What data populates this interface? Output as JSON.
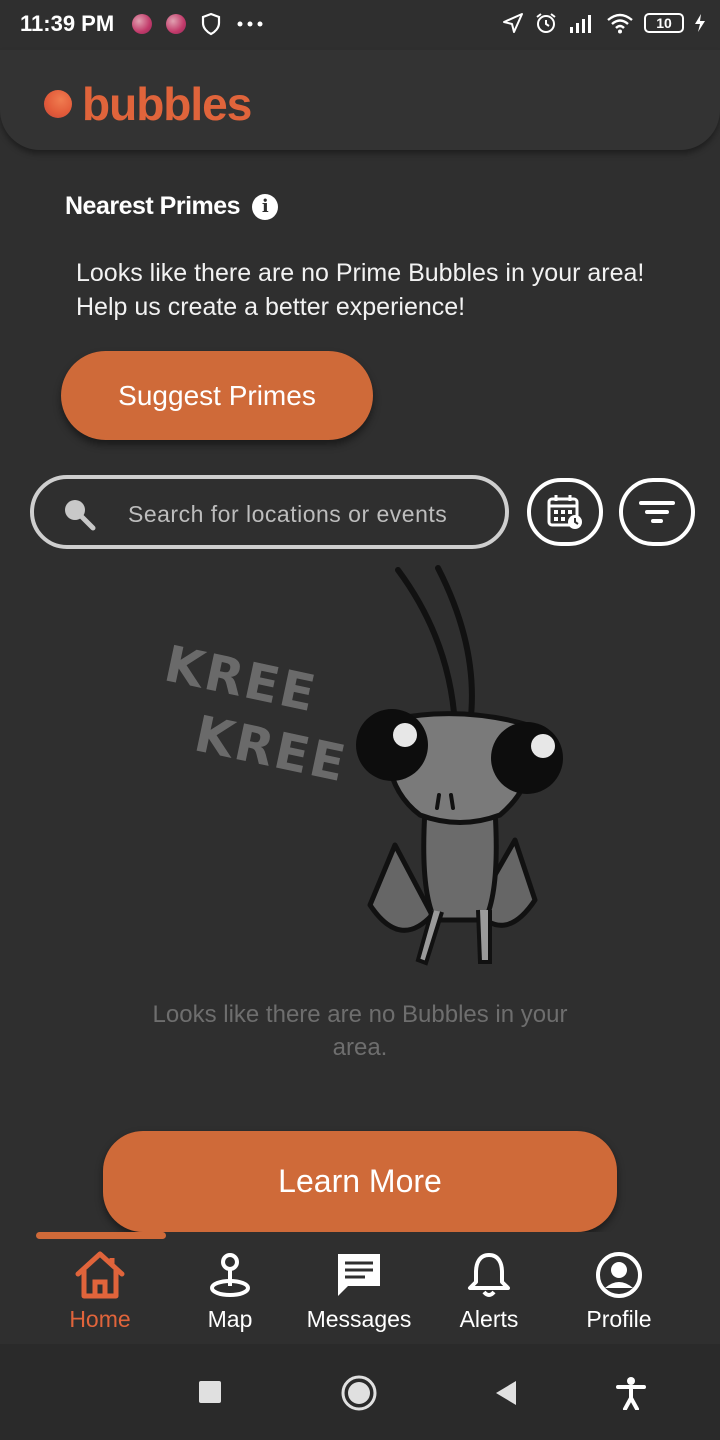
{
  "status_bar": {
    "time": "11:39 PM",
    "battery": "10"
  },
  "app": {
    "name": "bubbles"
  },
  "nearest_primes": {
    "title": "Nearest Primes",
    "message": "Looks like there are no Prime Bubbles in your area! Help us create a better experience!",
    "button": "Suggest Primes"
  },
  "search": {
    "placeholder": "Search for locations or events"
  },
  "illustration": {
    "line1": "KREE",
    "line2": "KREE"
  },
  "empty_state": {
    "message": "Looks like there are no Bubbles in your area."
  },
  "learn_more": {
    "label": "Learn More"
  },
  "tabs": [
    {
      "label": "Home",
      "icon": "home-icon",
      "active": true
    },
    {
      "label": "Map",
      "icon": "map-pin-icon"
    },
    {
      "label": "Messages",
      "icon": "messages-icon"
    },
    {
      "label": "Alerts",
      "icon": "bell-icon"
    },
    {
      "label": "Profile",
      "icon": "profile-icon"
    }
  ],
  "colors": {
    "accent": "#cf6a39",
    "background": "#2f2f2f",
    "logo": "#e0643b"
  }
}
